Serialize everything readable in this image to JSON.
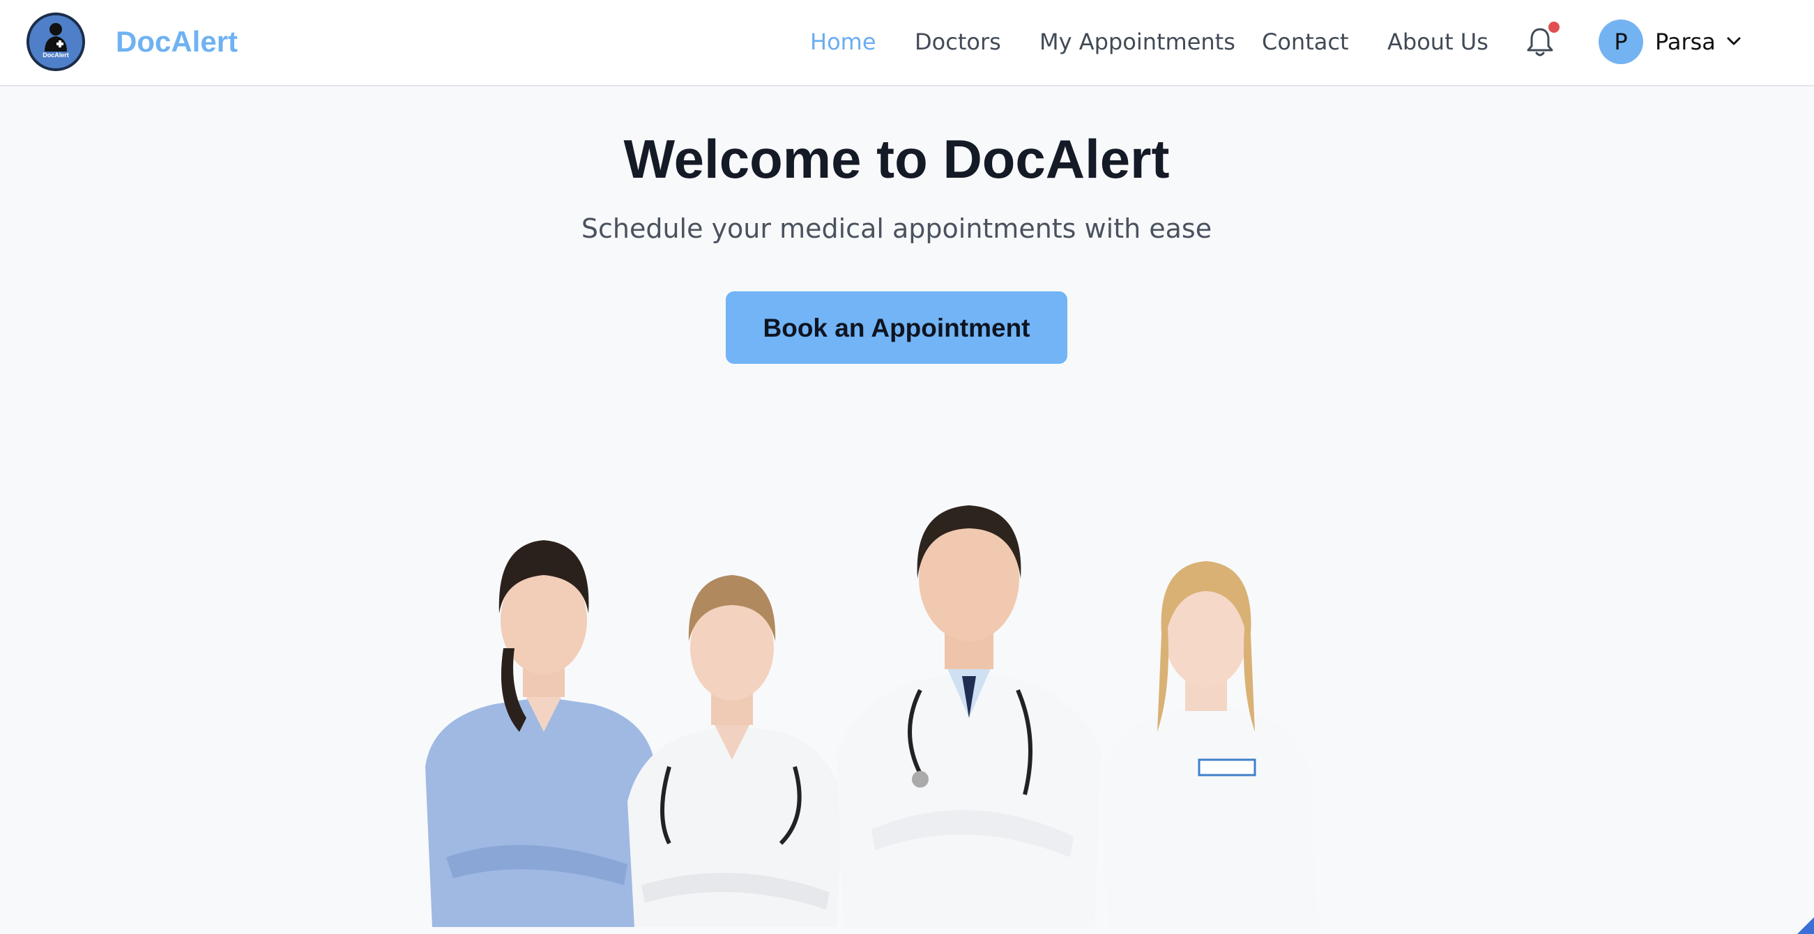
{
  "brand": {
    "name": "DocAlert",
    "logo_text": "DocAlert",
    "logo_icon": "doctor-silhouette-icon"
  },
  "nav": {
    "items": [
      {
        "label": "Home",
        "active": true
      },
      {
        "label": "Doctors",
        "active": false
      },
      {
        "label": "My Appointments",
        "active": false
      },
      {
        "label": "Contact",
        "active": false
      },
      {
        "label": "About Us",
        "active": false
      }
    ],
    "notification_icon": "bell-icon",
    "has_unread_notifications": true
  },
  "user": {
    "initial": "P",
    "name": "Parsa",
    "menu_icon": "chevron-down-icon"
  },
  "hero": {
    "title": "Welcome to DocAlert",
    "subtitle": "Schedule your medical appointments with ease",
    "cta_label": "Book an Appointment",
    "image": "group of four medical staff with crossed arms"
  },
  "colors": {
    "accent": "#72b4f5",
    "brand_text": "#6fb2f2",
    "active_nav": "#6aaef0",
    "notification_dot": "#e05050",
    "background": "#f8f9fb"
  }
}
